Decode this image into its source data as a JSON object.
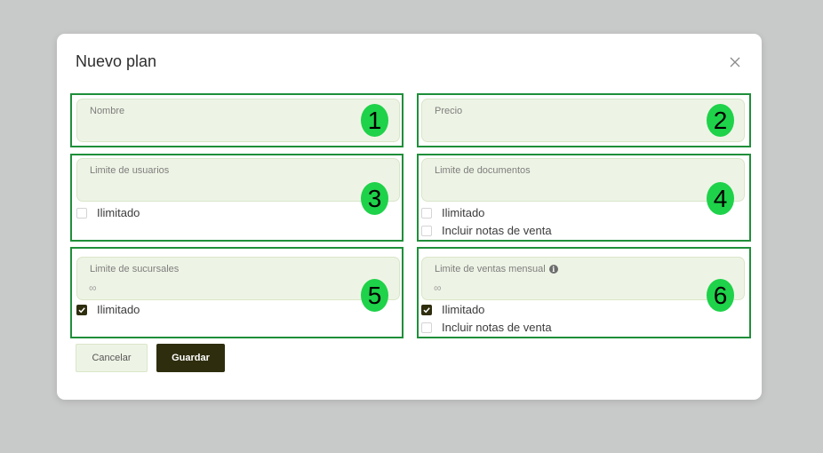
{
  "modal": {
    "title": "Nuevo plan",
    "close_icon": "close-icon"
  },
  "fields": {
    "nombre": {
      "label": "Nombre",
      "value": "",
      "placeholder": "",
      "badge": "1"
    },
    "precio": {
      "label": "Precio",
      "value": "",
      "placeholder": "",
      "badge": "2"
    },
    "usuarios": {
      "label": "Limite de usuarios",
      "value": "",
      "placeholder": "",
      "badge": "3",
      "unlimited": {
        "label": "Ilimitado",
        "checked": false
      }
    },
    "documentos": {
      "label": "Limite de documentos",
      "value": "",
      "placeholder": "",
      "badge": "4",
      "unlimited": {
        "label": "Ilimitado",
        "checked": false
      },
      "notas": {
        "label": "Incluir notas de venta",
        "checked": false
      }
    },
    "sucursales": {
      "label": "Limite de sucursales",
      "value": "",
      "placeholder": "∞",
      "badge": "5",
      "unlimited": {
        "label": "Ilimitado",
        "checked": true
      }
    },
    "ventas": {
      "label": "Limite de ventas mensual",
      "value": "",
      "placeholder": "∞",
      "badge": "6",
      "info_icon": "info-icon",
      "unlimited": {
        "label": "Ilimitado",
        "checked": true
      },
      "notas": {
        "label": "Incluir notas de venta",
        "checked": false
      }
    }
  },
  "buttons": {
    "cancel": "Cancelar",
    "save": "Guardar"
  },
  "colors": {
    "section_border": "#1f8f3a",
    "badge_bg": "#1ed24a",
    "field_bg": "#eef4e5",
    "primary": "#2e2d0e"
  }
}
